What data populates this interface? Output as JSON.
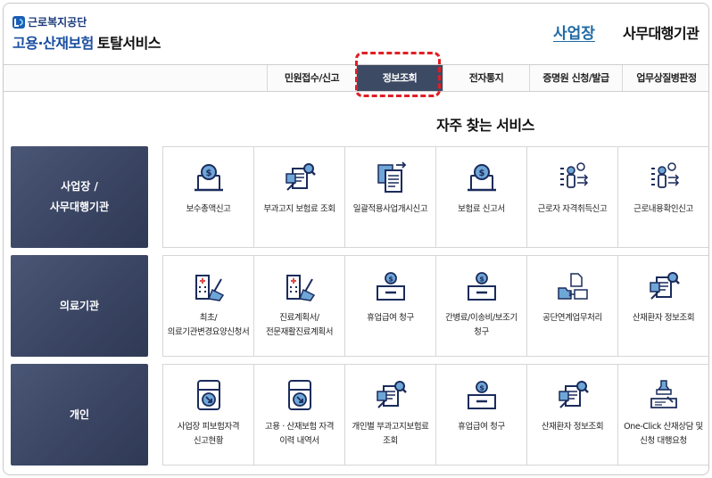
{
  "header": {
    "logo_org": "근로복지공단",
    "logo_title": "고용·산재보험",
    "logo_suffix": "토탈서비스",
    "link_business": "사업장",
    "link_agent": "사무대행기관"
  },
  "gnb": {
    "items": [
      {
        "label": "민원접수/신고"
      },
      {
        "label": "정보조회"
      },
      {
        "label": "전자통지"
      },
      {
        "label": "증명원 신청/발급"
      },
      {
        "label": "업무상질병판정"
      }
    ],
    "active": "정보조회"
  },
  "section_title": "자주 찾는 서비스",
  "rows": [
    {
      "category": "사업장 /\n사무대행기관",
      "services": [
        {
          "label": "보수총액신고",
          "icon": "laptop-coin-icon"
        },
        {
          "label": "부과고지 보험료 조회",
          "icon": "document-search-icon"
        },
        {
          "label": "일괄적용사업개시신고",
          "icon": "documents-arrow-icon"
        },
        {
          "label": "보험료 신고서",
          "icon": "laptop-coin-icon"
        },
        {
          "label": "근로자 자격취득신고",
          "icon": "person-list-icon"
        },
        {
          "label": "근로내용확인신고",
          "icon": "person-list-icon"
        }
      ]
    },
    {
      "category": "의료기관",
      "services": [
        {
          "label": "최초/의료기관변경요양신청서",
          "icon": "hospital-pen-icon"
        },
        {
          "label": "진료계획서/전문재활진료계획서",
          "icon": "hospital-pen-icon"
        },
        {
          "label": "휴업급여 청구",
          "icon": "coin-box-icon"
        },
        {
          "label": "간병료/이송비/보조기 청구",
          "icon": "coin-box-icon"
        },
        {
          "label": "공단연계업무처리",
          "icon": "folder-exchange-icon"
        },
        {
          "label": "산재환자 정보조회",
          "icon": "document-search-icon"
        }
      ]
    },
    {
      "category": "개인",
      "services": [
        {
          "label": "사업장 피보험자격 신고현황",
          "icon": "tray-arrow-icon"
        },
        {
          "label": "고용 · 산재보험 자격 이력 내역서",
          "icon": "tray-arrow-icon"
        },
        {
          "label": "개인별 부과고지보험료 조회",
          "icon": "document-search-icon"
        },
        {
          "label": "휴업급여 청구",
          "icon": "coin-box-icon"
        },
        {
          "label": "산재환자 정보조회",
          "icon": "document-search-icon"
        },
        {
          "label": "One-Click 산재상담 및 신청 대행요청",
          "icon": "hand-stamp-icon"
        }
      ]
    }
  ],
  "colors": {
    "accent_blue": "#1f6aa5",
    "category_bg": "#3a4563",
    "icon_navy": "#1b2c5c",
    "icon_fill": "#6fa6d8",
    "highlight": "#e01f26"
  }
}
